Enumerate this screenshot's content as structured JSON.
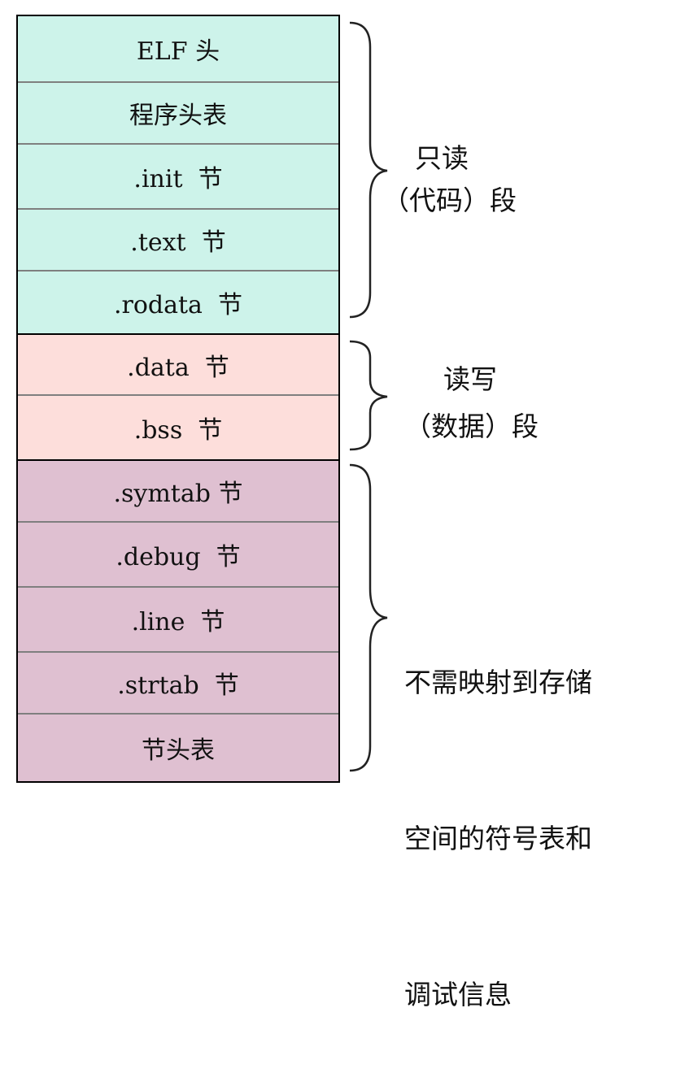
{
  "colors": {
    "readonly_fill": "#cdf3ea",
    "readwrite_fill": "#fddedb",
    "nonmapped_fill": "#dfc0d1",
    "border": "#000000",
    "row_divider": "#7f7f7f"
  },
  "groups": [
    {
      "id": "readonly",
      "label_lines": [
        "只读",
        "（代码）段"
      ],
      "rows": [
        "ELF 头",
        "程序头表",
        ".init  节",
        ".text  节",
        ".rodata  节"
      ]
    },
    {
      "id": "readwrite",
      "label_lines": [
        "读写",
        "（数据）段"
      ],
      "rows": [
        ".data  节",
        ".bss  节"
      ]
    },
    {
      "id": "nonmapped",
      "label_lines": [
        "不需映射到存储",
        "空间的符号表和",
        "调试信息"
      ],
      "rows": [
        ".symtab 节",
        ".debug  节",
        ".line  节",
        ".strtab  节",
        "节头表"
      ]
    }
  ]
}
